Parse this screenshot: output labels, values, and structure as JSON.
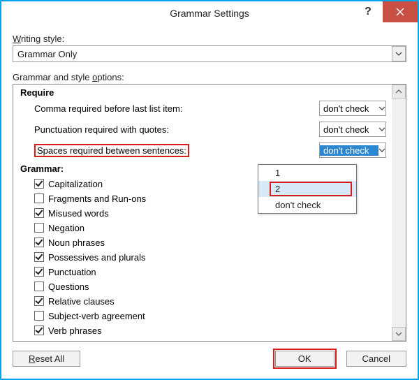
{
  "window": {
    "title": "Grammar Settings"
  },
  "writing_style": {
    "label": "Writing style:",
    "value": "Grammar Only"
  },
  "options_label_pre": "Grammar and style ",
  "options_label_u": "o",
  "options_label_post": "ptions:",
  "require": {
    "heading": "Require",
    "rows": [
      {
        "label": "Comma required before last list item:",
        "value": "don't check",
        "highlight": false,
        "redbox": false
      },
      {
        "label": "Punctuation required with quotes:",
        "value": "don't check",
        "highlight": false,
        "redbox": false
      },
      {
        "label": "Spaces required between sentences:",
        "value": "don't check",
        "highlight": true,
        "redbox": true
      }
    ]
  },
  "grammar": {
    "heading": "Grammar:",
    "items": [
      {
        "label": "Capitalization",
        "checked": true
      },
      {
        "label": "Fragments and Run-ons",
        "checked": false
      },
      {
        "label": "Misused words",
        "checked": true
      },
      {
        "label": "Negation",
        "checked": false
      },
      {
        "label": "Noun phrases",
        "checked": true
      },
      {
        "label": "Possessives and plurals",
        "checked": true
      },
      {
        "label": "Punctuation",
        "checked": true
      },
      {
        "label": "Questions",
        "checked": false
      },
      {
        "label": "Relative clauses",
        "checked": true
      },
      {
        "label": "Subject-verb agreement",
        "checked": false
      },
      {
        "label": "Verb phrases",
        "checked": true
      }
    ]
  },
  "dropdown": {
    "items": [
      {
        "label": "1",
        "hover": false,
        "red": false
      },
      {
        "label": "2",
        "hover": true,
        "red": true
      },
      {
        "label": "don't check",
        "hover": false,
        "red": false
      }
    ]
  },
  "buttons": {
    "reset_u": "R",
    "reset_rest": "eset All",
    "ok": "OK",
    "cancel": "Cancel"
  }
}
